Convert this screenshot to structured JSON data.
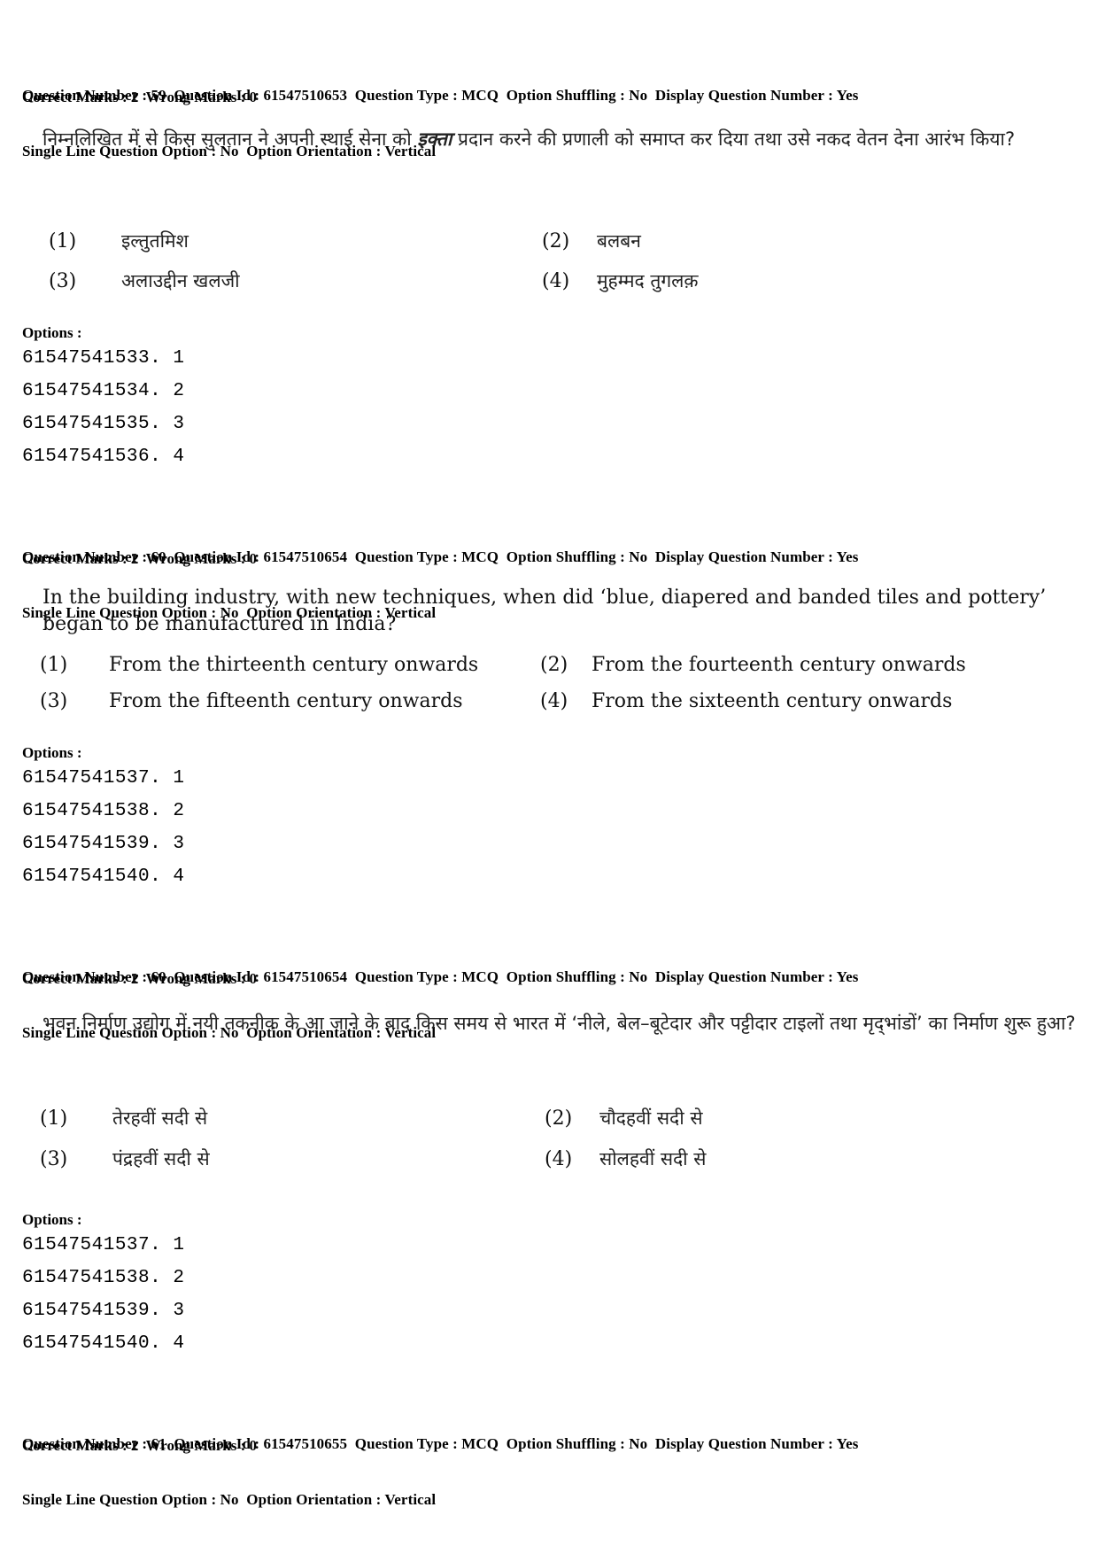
{
  "questions": [
    {
      "meta_line1": "Question Number : 59  Question Id : 61547510653  Question Type : MCQ  Option Shuffling : No  Display Question Number : Yes",
      "meta_line2": "Single Line Question Option : No  Option Orientation : Vertical",
      "marks": "Correct Marks : 2  Wrong Marks : 0",
      "text_before": "निम्नलिखित में से किस सुलतान ने अपनी स्थाई सेना को ",
      "text_italic": "इक्ता",
      "text_after": " प्रदान करने की प्रणाली को समाप्त कर दिया तथा उसे नकद वेतन देना आरंभ किया?",
      "options": [
        {
          "num": "(1)",
          "text": "इल्तुतमिश"
        },
        {
          "num": "(2)",
          "text": "बलबन"
        },
        {
          "num": "(3)",
          "text": "अलाउद्दीन खलजी"
        },
        {
          "num": "(4)",
          "text": "मुहम्मद तुगलक़"
        }
      ],
      "options_label": "Options :",
      "option_ids": [
        "61547541533. 1",
        "61547541534. 2",
        "61547541535. 3",
        "61547541536. 4"
      ]
    },
    {
      "meta_line1": "Question Number : 60  Question Id : 61547510654  Question Type : MCQ  Option Shuffling : No  Display Question Number : Yes",
      "meta_line2": "Single Line Question Option : No  Option Orientation : Vertical",
      "marks": "Correct Marks : 2  Wrong Marks : 0",
      "text": "In the building industry, with new techniques, when did ‘blue, diapered and banded tiles and pottery’ began to be manufactured in India?",
      "options": [
        {
          "num": "(1)",
          "text": "From the thirteenth century onwards"
        },
        {
          "num": "(2)",
          "text": "From the fourteenth century onwards"
        },
        {
          "num": "(3)",
          "text": "From the fifteenth century onwards"
        },
        {
          "num": "(4)",
          "text": "From the sixteenth century onwards"
        }
      ],
      "options_label": "Options :",
      "option_ids": [
        "61547541537. 1",
        "61547541538. 2",
        "61547541539. 3",
        "61547541540. 4"
      ]
    },
    {
      "meta_line1": "Question Number : 60  Question Id : 61547510654  Question Type : MCQ  Option Shuffling : No  Display Question Number : Yes",
      "meta_line2": "Single Line Question Option : No  Option Orientation : Vertical",
      "marks": "Correct Marks : 2  Wrong Marks : 0",
      "text": "भवन निर्माण उद्योग में नयी तकनीक के आ जाने के बाद किस समय से भारत में ‘नीले, बेल–बूटेदार और पट्टीदार टाइलों तथा मृद्‌भांडों’ का निर्माण शुरू हुआ?",
      "options": [
        {
          "num": "(1)",
          "text": "तेरहवीं सदी से"
        },
        {
          "num": "(2)",
          "text": "चौदहवीं सदी से"
        },
        {
          "num": "(3)",
          "text": "पंद्रहवीं सदी से"
        },
        {
          "num": "(4)",
          "text": "सोलहवीं सदी से"
        }
      ],
      "options_label": "Options :",
      "option_ids": [
        "61547541537. 1",
        "61547541538. 2",
        "61547541539. 3",
        "61547541540. 4"
      ]
    },
    {
      "meta_line1": "Question Number : 61  Question Id : 61547510655  Question Type : MCQ  Option Shuffling : No  Display Question Number : Yes",
      "meta_line2": "Single Line Question Option : No  Option Orientation : Vertical",
      "marks": "Correct Marks : 2  Wrong Marks : 0"
    }
  ]
}
